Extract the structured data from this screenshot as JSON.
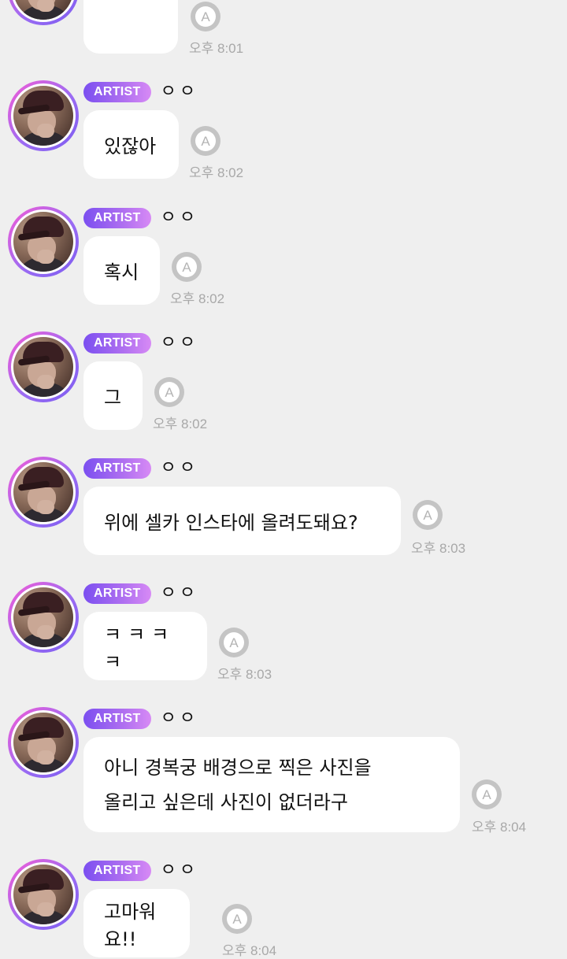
{
  "colors": {
    "background": "#efefef",
    "bubble": "#ffffff",
    "badge_start": "#7b4ff0",
    "badge_end": "#d78af5",
    "time_text": "#a8a8a8",
    "read_icon": "#bdbdbd"
  },
  "icons": {
    "read": "a-in-circle-icon"
  },
  "messages": [
    {
      "badge": "",
      "nickname": "",
      "text": "",
      "time": "오후 8:01"
    },
    {
      "badge": "ARTIST",
      "nickname": "ㅇㅇ",
      "text": "있잖아",
      "time": "오후 8:02"
    },
    {
      "badge": "ARTIST",
      "nickname": "ㅇㅇ",
      "text": "혹시",
      "time": "오후 8:02"
    },
    {
      "badge": "ARTIST",
      "nickname": "ㅇㅇ",
      "text": "그",
      "time": "오후 8:02"
    },
    {
      "badge": "ARTIST",
      "nickname": "ㅇㅇ",
      "text": "위에 셀카 인스타에 올려도돼요?",
      "time": "오후 8:03"
    },
    {
      "badge": "ARTIST",
      "nickname": "ㅇㅇ",
      "text": "ㅋㅋㅋㅋ",
      "time": "오후 8:03"
    },
    {
      "badge": "ARTIST",
      "nickname": "ㅇㅇ",
      "text": "아니 경복궁 배경으로 찍은 사진을\n올리고 싶은데 사진이 없더라구",
      "time": "오후 8:04"
    },
    {
      "badge": "ARTIST",
      "nickname": "ㅇㅇ",
      "text": "고마워요!!",
      "time": "오후 8:04"
    }
  ]
}
